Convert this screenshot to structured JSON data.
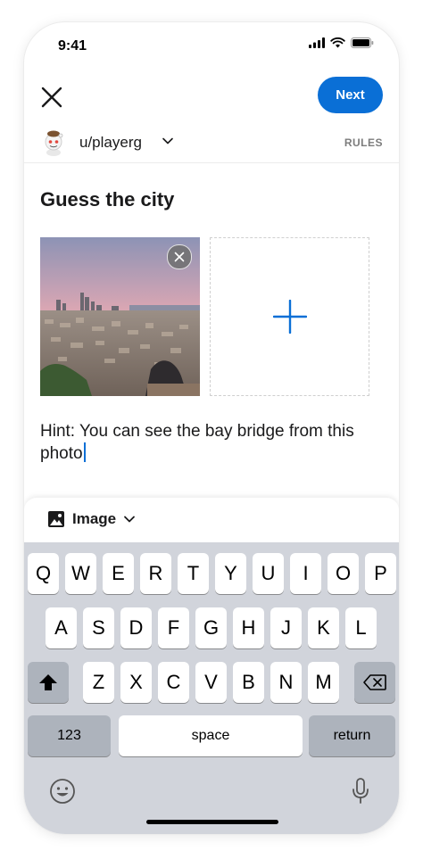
{
  "status_bar": {
    "time": "9:41"
  },
  "nav": {
    "close_icon": "close-icon",
    "next_label": "Next"
  },
  "community": {
    "name": "u/playerg",
    "rules_label": "RULES"
  },
  "post": {
    "title": "Guess the city",
    "body_text": "Hint: You can see the bay bridge from this photo"
  },
  "toolbar": {
    "image_label": "Image"
  },
  "keyboard": {
    "row1": [
      "Q",
      "W",
      "E",
      "R",
      "T",
      "Y",
      "U",
      "I",
      "O",
      "P"
    ],
    "row2": [
      "A",
      "S",
      "D",
      "F",
      "G",
      "H",
      "J",
      "K",
      "L"
    ],
    "row3": [
      "Z",
      "X",
      "C",
      "V",
      "B",
      "N",
      "M"
    ],
    "numbers_label": "123",
    "space_label": "space",
    "return_label": "return"
  },
  "colors": {
    "accent": "#0a6fd6",
    "keyboard_bg": "#d1d4db"
  }
}
